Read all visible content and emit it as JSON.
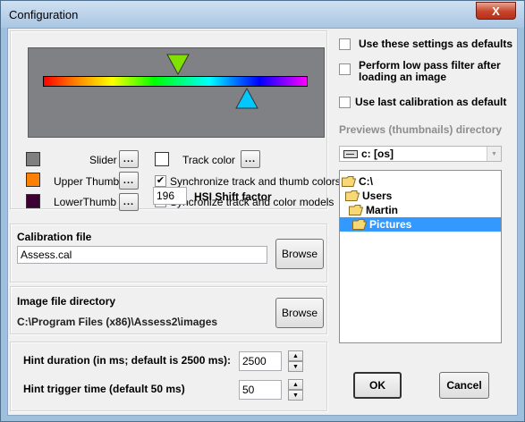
{
  "window": {
    "title": "Configuration",
    "close_label": "X"
  },
  "slider_panel": {
    "rows": [
      {
        "label": "Slider",
        "color": "#7f7f7f",
        "button": "..."
      },
      {
        "label": "Upper Thumb",
        "color": "#ff8000",
        "button": "..."
      },
      {
        "label": "LowerThumb",
        "color": "#3c0032",
        "button": "..."
      }
    ],
    "track_color": {
      "label": "Track color",
      "color": "#ffffff",
      "button": "..."
    },
    "sync_thumb": {
      "label": "Synchronize track and thumb colors",
      "checked": true
    },
    "sync_models": {
      "label": "Syncronize track and color models",
      "checked": true
    },
    "hsi": {
      "value": "196",
      "label": "HSI Shift factor"
    }
  },
  "calibration": {
    "title": "Calibration file",
    "value": "Assess.cal",
    "browse_label": "Browse"
  },
  "image_dir": {
    "title": "Image file directory",
    "path": "C:\\Program Files (x86)\\Assess2\\images",
    "browse_label": "Browse"
  },
  "hints": {
    "duration_label": "Hint duration (in ms; default is 2500 ms):",
    "duration_value": "2500",
    "trigger_label": "Hint trigger time (default 50 ms)",
    "trigger_value": "50"
  },
  "options": {
    "use_default": {
      "label": "Use these settings as defaults",
      "checked": false
    },
    "low_pass": {
      "label": "Perform low pass filter after loading an image",
      "checked": false
    },
    "last_calibration": {
      "label": "Use last calibration as default",
      "checked": false
    }
  },
  "previews": {
    "label": "Previews (thumbnails) directory",
    "drive": "c: [os]",
    "tree": [
      {
        "label": "C:\\",
        "selected": false
      },
      {
        "label": "Users",
        "selected": false
      },
      {
        "label": "Martin",
        "selected": false
      },
      {
        "label": "Pictures",
        "selected": true
      }
    ]
  },
  "buttons": {
    "ok": "OK",
    "cancel": "Cancel"
  },
  "colors": {
    "spectrum_bg": "#7f8185",
    "upper_thumb": "#80e000",
    "lower_thumb": "#00c8ff",
    "selection": "#3399ff"
  },
  "icons": {
    "check": "✔",
    "spin_up": "▲",
    "spin_down": "▼",
    "combo_arrow": "▼"
  }
}
